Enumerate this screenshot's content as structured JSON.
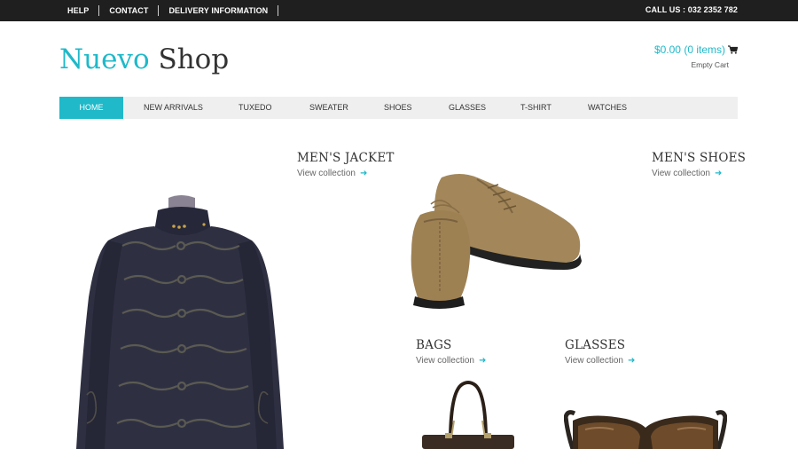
{
  "topbar": {
    "links": [
      "HELP",
      "CONTACT",
      "DELIVERY INFORMATION"
    ],
    "call": "CALL US : 032 2352 782"
  },
  "logo": {
    "part1": "Nuevo",
    "part2": " Shop"
  },
  "cart": {
    "total": "$0.00 (0 items)",
    "empty": "Empty Cart",
    "icon": "cart-icon"
  },
  "nav": {
    "items": [
      "HOME",
      "NEW ARRIVALS",
      "TUXEDO",
      "SWEATER",
      "SHOES",
      "GLASSES",
      "T-SHIRT",
      "WATCHES"
    ],
    "active": "HOME"
  },
  "collections": {
    "jacket": {
      "title": "MEN'S JACKET",
      "link": "View collection"
    },
    "shoes": {
      "title": "MEN'S SHOES",
      "link": "View collection"
    },
    "bags": {
      "title": "BAGS",
      "link": "View collection"
    },
    "glasses": {
      "title": "GLASSES",
      "link": "View collection"
    }
  },
  "colors": {
    "accent": "#1fb9c9",
    "topbar": "#1f1f1f",
    "nav_bg": "#efefef"
  }
}
